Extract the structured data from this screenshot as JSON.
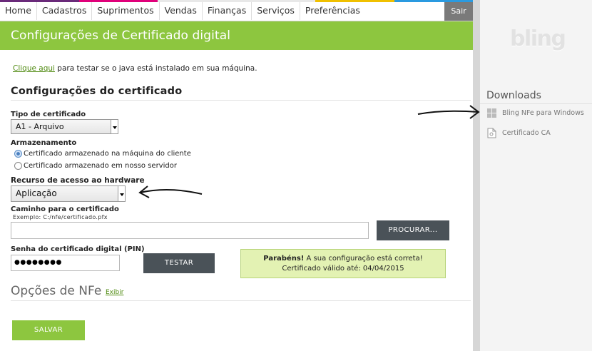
{
  "nav": {
    "items": [
      {
        "label": "Home"
      },
      {
        "label": "Cadastros"
      },
      {
        "label": "Suprimentos"
      },
      {
        "label": "Vendas"
      },
      {
        "label": "Finanças"
      },
      {
        "label": "Serviços"
      },
      {
        "label": "Preferências"
      }
    ],
    "logout": "Sair"
  },
  "header": {
    "title": "Configurações de Certificado digital"
  },
  "java_check": {
    "link": "Clique aqui",
    "text": " para testar se o java está instalado em sua máquina."
  },
  "certificate": {
    "title": "Configurações do certificado",
    "type_label": "Tipo de certificado",
    "type_value": "A1 - Arquivo",
    "storage_label": "Armazenamento",
    "storage_options": [
      {
        "label": "Certificado armazenado na máquina do cliente",
        "selected": true
      },
      {
        "label": "Certificado armazenado em nosso servidor",
        "selected": false
      }
    ],
    "hardware_label": "Recurso de acesso ao hardware",
    "hardware_value": "Aplicação",
    "path_label": "Caminho para o certificado",
    "path_example": "Exemplo: C:/nfe/certificado.pfx",
    "path_value": "",
    "browse_button": "PROCURAR...",
    "pin_label": "Senha do certificado digital (PIN)",
    "pin_value": "●●●●●●●●",
    "test_button": "TESTAR"
  },
  "success": {
    "strong": "Parabéns!",
    "message": " A sua configuração está correta!",
    "validity": "Certificado válido até: 04/04/2015"
  },
  "nfe": {
    "title": "Opções de NFe",
    "toggle": "Exibir"
  },
  "save_button": "SALVAR",
  "sidebar": {
    "logo": "bling",
    "downloads_title": "Downloads",
    "downloads": [
      {
        "label": "Bling NFe para Windows",
        "icon": "windows-icon"
      },
      {
        "label": "Certificado CA",
        "icon": "certificate-file-icon"
      }
    ]
  },
  "colors": {
    "brand_green": "#8dc63f",
    "dark_button": "#4a5258",
    "success_bg": "#e3f2b3"
  }
}
